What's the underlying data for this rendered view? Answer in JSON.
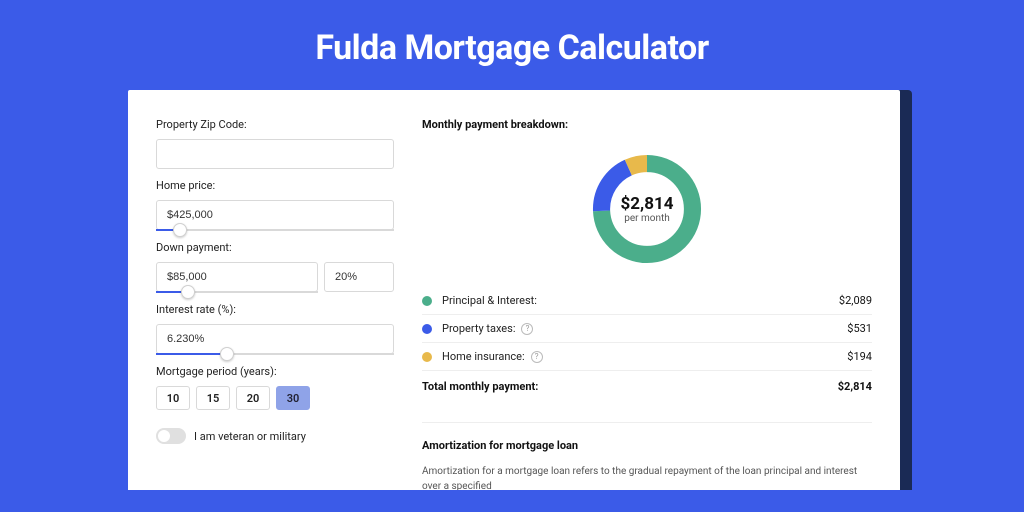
{
  "colors": {
    "green": "#4BAE8B",
    "blue": "#3B5BE8",
    "yellow": "#E8B94B"
  },
  "page": {
    "title": "Fulda Mortgage Calculator"
  },
  "form": {
    "zip": {
      "label": "Property Zip Code:",
      "value": ""
    },
    "price": {
      "label": "Home price:",
      "value": "$425,000",
      "slider_pct": 10
    },
    "down": {
      "label": "Down payment:",
      "amount": "$85,000",
      "pct": "20%",
      "slider_pct": 20
    },
    "rate": {
      "label": "Interest rate (%):",
      "value": "6.230%",
      "slider_pct": 30
    },
    "period": {
      "label": "Mortgage period (years):",
      "options": [
        "10",
        "15",
        "20",
        "30"
      ],
      "active": "30"
    },
    "veteran": {
      "label": "I am veteran or military",
      "on": false
    }
  },
  "breakdown": {
    "title": "Monthly payment breakdown:",
    "center_amount": "$2,814",
    "center_sub": "per month",
    "items": [
      {
        "label": "Principal & Interest:",
        "value": "$2,089",
        "color": "#4BAE8B",
        "info": false
      },
      {
        "label": "Property taxes:",
        "value": "$531",
        "color": "#3B5BE8",
        "info": true
      },
      {
        "label": "Home insurance:",
        "value": "$194",
        "color": "#E8B94B",
        "info": true
      }
    ],
    "total_label": "Total monthly payment:",
    "total_value": "$2,814"
  },
  "chart_data": {
    "type": "pie",
    "title": "Monthly payment breakdown",
    "categories": [
      "Principal & Interest",
      "Property taxes",
      "Home insurance"
    ],
    "values": [
      2089,
      531,
      194
    ],
    "colors": [
      "#4BAE8B",
      "#3B5BE8",
      "#E8B94B"
    ],
    "center_label": "$2,814 per month"
  },
  "amortization": {
    "title": "Amortization for mortgage loan",
    "body": "Amortization for a mortgage loan refers to the gradual repayment of the loan principal and interest over a specified"
  }
}
